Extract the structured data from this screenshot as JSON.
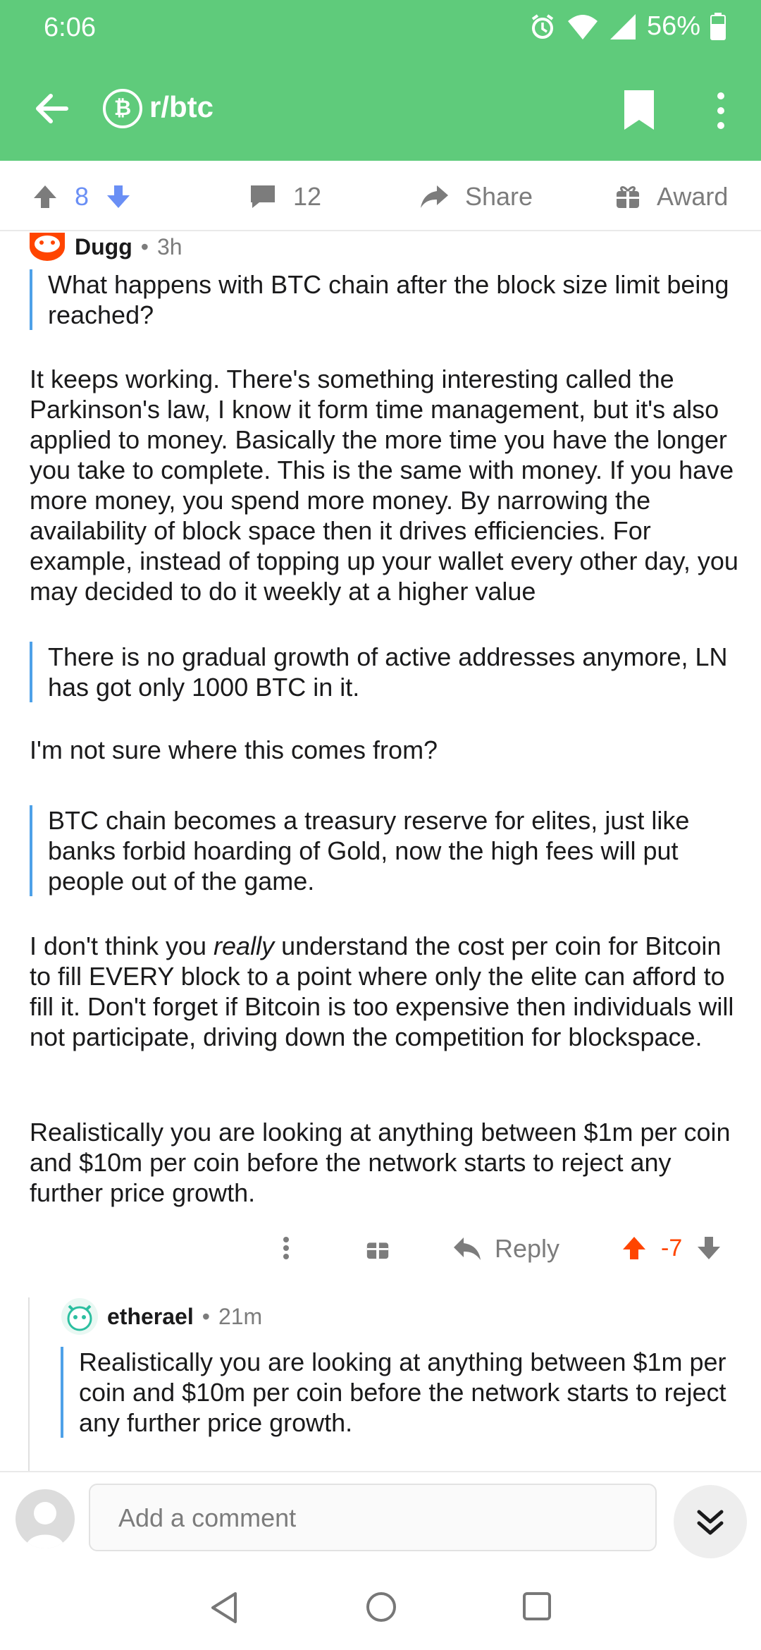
{
  "status": {
    "time": "6:06",
    "battery": "56%"
  },
  "header": {
    "subreddit": "r/btc",
    "subreddit_icon": "bitcoin-icon"
  },
  "post_actions": {
    "upvotes": "8",
    "comments": "12",
    "share": "Share",
    "award": "Award"
  },
  "comment": {
    "author": "Dugg",
    "age": "3h",
    "paragraphs": {
      "q1": "What happens with BTC chain after the block size limit being reached?",
      "p1": "It keeps working. There's something interesting called the Parkinson's law, I know it form time management, but it's also applied to money. Basically the more time you have the longer you take to complete. This is the same with money. If you have more money, you spend more money. By narrowing the availability of block space then it drives efficiencies. For example, instead of topping up your wallet every other day, you may decided to do it weekly at a higher value",
      "q2": "There is no gradual growth of active addresses anymore, LN has got only 1000 BTC in it.",
      "p2": "I'm not sure where this comes from?",
      "q3": "BTC chain becomes a treasury reserve for elites, just like banks forbid hoarding of Gold, now the high fees will put people out of the game.",
      "p3_before": "I don't think you ",
      "p3_em": "really",
      "p3_after": " understand the cost per coin for Bitcoin to fill EVERY block to a point where only the elite can afford to fill it. Don't forget if Bitcoin is too expensive then individuals will not participate, driving down the competition for blockspace.",
      "p4": "Realistically you are looking at anything between $1m per coin and $10m per coin before the network starts to reject any further price growth."
    },
    "reply_label": "Reply",
    "score": "-7"
  },
  "reply": {
    "author": "etherael",
    "age": "21m",
    "quote": "Realistically you are looking at anything between $1m per coin and $10m per coin before the network starts to reject any further price growth."
  },
  "composer": {
    "placeholder": "Add a comment"
  },
  "colors": {
    "accent": "#5fcb7b",
    "quote_bar": "#4ea1e8",
    "upvote_orange": "#ff4500",
    "vote_blue": "#6a8ff5"
  }
}
